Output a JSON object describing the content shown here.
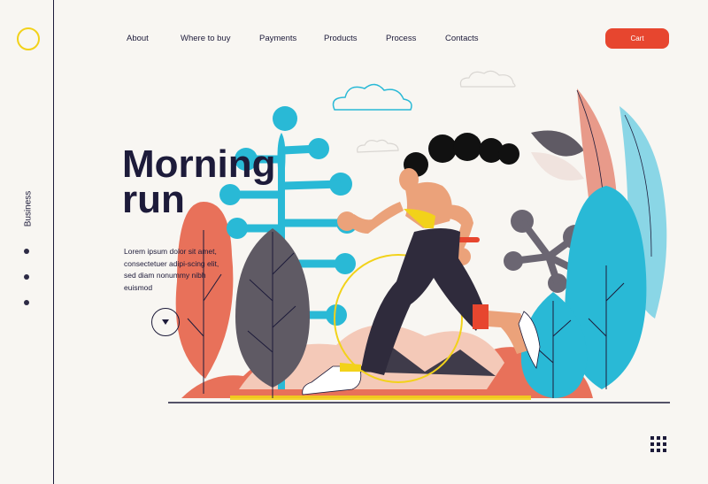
{
  "sidebar": {
    "label": "Business",
    "dots": 3
  },
  "nav": {
    "items": [
      {
        "label": "About"
      },
      {
        "label": "Where to buy"
      },
      {
        "label": "Payments"
      },
      {
        "label": "Products"
      },
      {
        "label": "Process"
      },
      {
        "label": "Contacts"
      }
    ],
    "cart_label": "Cart"
  },
  "hero": {
    "title_line1": "Morning",
    "title_line2": "run",
    "body": "Lorem ipsum dolor sit amet, consectetuer adipi-scing elit, sed diam nonummy nibh euismod"
  },
  "colors": {
    "accent": "#e7462f",
    "logo_ring": "#f2d21a",
    "ink": "#1d1b3a",
    "background": "#f8f6f2",
    "sky_blue": "#29b9d6",
    "coral": "#e8715a",
    "slate": "#5f5a64",
    "yellow": "#f2d21a"
  },
  "icons": [
    "logo-circle-icon",
    "chevron-down-icon",
    "grid-menu-icon",
    "cloud-icon"
  ]
}
